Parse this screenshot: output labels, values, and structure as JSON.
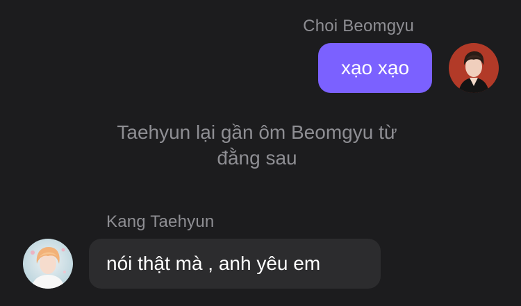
{
  "messages": {
    "outgoing": {
      "sender": "Choi Beomgyu",
      "text": "xạo xạo",
      "avatar_icon": "profile-photo-icon",
      "bubble_color": "#7b61ff"
    },
    "narration": {
      "line1": "Taehyun lại gần ôm Beomgyu từ",
      "line2": "đằng sau"
    },
    "incoming": {
      "sender": "Kang Taehyun",
      "text": "nói thật mà , anh yêu em",
      "avatar_icon": "profile-photo-icon",
      "bubble_color": "#2c2c2e"
    }
  },
  "theme": {
    "background": "#1c1c1e",
    "secondary_text": "#8e8e93"
  }
}
